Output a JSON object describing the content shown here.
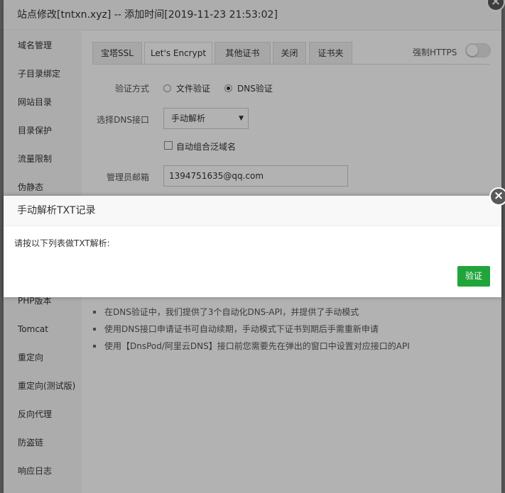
{
  "panel": {
    "title": "站点修改[tntxn.xyz] -- 添加时间[2019-11-23 21:53:02]",
    "close_icon": "×"
  },
  "sidebar": {
    "items": [
      {
        "label": "域名管理"
      },
      {
        "label": "子目录绑定"
      },
      {
        "label": "网站目录"
      },
      {
        "label": "目录保护"
      },
      {
        "label": "流量限制"
      },
      {
        "label": "伪静态"
      },
      {
        "label": ""
      },
      {
        "label": ""
      },
      {
        "label": ""
      },
      {
        "label": "PHP版本"
      },
      {
        "label": "Tomcat"
      },
      {
        "label": "重定向"
      },
      {
        "label": "重定向(测试版)"
      },
      {
        "label": "反向代理"
      },
      {
        "label": "防盗链"
      },
      {
        "label": "响应日志"
      }
    ]
  },
  "tabs": [
    {
      "label": "宝塔SSL"
    },
    {
      "label": "Let's Encrypt",
      "active": true
    },
    {
      "label": "其他证书"
    },
    {
      "label": "关闭"
    },
    {
      "label": "证书夹"
    }
  ],
  "force_https": {
    "label": "强制HTTPS",
    "enabled": false
  },
  "form": {
    "verify_label": "验证方式",
    "option_file": "文件验证",
    "option_dns": "DNS验证",
    "selected_option": "DNS验证",
    "dns_label": "选择DNS接口",
    "dns_value": "手动解析",
    "dns_arrow": "▼",
    "wildcard_label": "自动组合泛域名",
    "wildcard_checked": false,
    "email_label": "管理员邮箱",
    "email_value": "1394751635@qq.com"
  },
  "tips": [
    "在DNS验证中，我们提供了3个自动化DNS-API，并提供了手动模式",
    "使用DNS接口申请证书可自动续期，手动模式下证书到期后手需重新申请",
    "使用【DnsPod/阿里云DNS】接口前您需要先在弹出的窗口中设置对应接口的API"
  ],
  "dialog": {
    "title": "手动解析TXT记录",
    "body": "请按以下列表做TXT解析:",
    "verify_button": "验证",
    "close_icon": "×"
  },
  "colors": {
    "accent": "#20a53a"
  }
}
